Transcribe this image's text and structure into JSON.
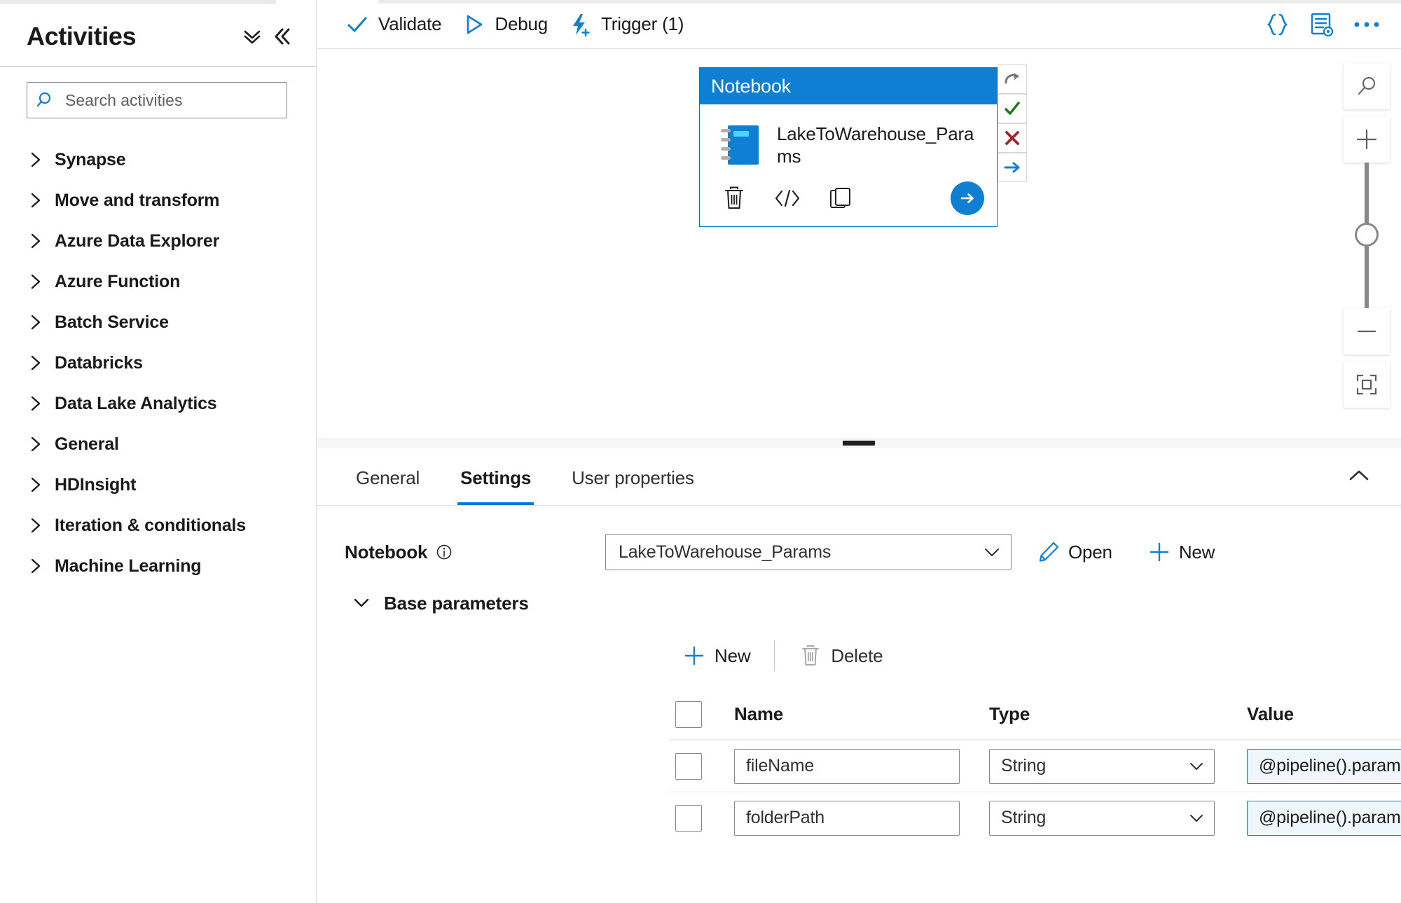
{
  "sidebar": {
    "title": "Activities",
    "collapse_all_icon": "double-chevron-down-icon",
    "collapse_panel_icon": "double-chevron-left-icon",
    "search": {
      "placeholder": "Search activities",
      "value": "",
      "icon": "search-icon"
    },
    "categories": [
      {
        "label": "Synapse",
        "expanded": false
      },
      {
        "label": "Move and transform",
        "expanded": false
      },
      {
        "label": "Azure Data Explorer",
        "expanded": false
      },
      {
        "label": "Azure Function",
        "expanded": false
      },
      {
        "label": "Batch Service",
        "expanded": false
      },
      {
        "label": "Databricks",
        "expanded": false
      },
      {
        "label": "Data Lake Analytics",
        "expanded": false
      },
      {
        "label": "General",
        "expanded": false
      },
      {
        "label": "HDInsight",
        "expanded": false
      },
      {
        "label": "Iteration & conditionals",
        "expanded": false
      },
      {
        "label": "Machine Learning",
        "expanded": false
      }
    ]
  },
  "commandbar": {
    "validate_label": "Validate",
    "validate_icon": "checkmark-icon",
    "debug_label": "Debug",
    "debug_icon": "play-triangle-icon",
    "trigger_label": "Trigger (1)",
    "trigger_icon": "lightning-bolt-plus-icon",
    "code_icon": "curly-braces-icon",
    "properties_icon": "document-gear-icon",
    "more_icon": "ellipsis-icon"
  },
  "canvas": {
    "node": {
      "type_label": "Notebook",
      "activity_name": "LakeToWarehouse_Params",
      "activity_icon": "notebook-icon",
      "actions": [
        {
          "name": "delete",
          "icon": "trash-icon"
        },
        {
          "name": "code",
          "icon": "code-brackets-icon"
        },
        {
          "name": "clone",
          "icon": "copy-icon"
        },
        {
          "name": "run",
          "icon": "arrow-right-circle-icon"
        }
      ],
      "handles": [
        {
          "name": "on-skip",
          "icon": "curved-arrow-icon",
          "color": "#797775"
        },
        {
          "name": "on-success",
          "icon": "checkmark-icon",
          "color": "#107c10"
        },
        {
          "name": "on-failure",
          "icon": "x-icon",
          "color": "#a4262c"
        },
        {
          "name": "on-completion",
          "icon": "arrow-right-icon",
          "color": "#0f7fd4"
        }
      ]
    },
    "zoom_controls": [
      {
        "name": "zoom-search",
        "icon": "magnifier-icon"
      },
      {
        "name": "zoom-in",
        "icon": "plus-icon"
      },
      {
        "name": "zoom-slider",
        "icon": "slider-thumb"
      },
      {
        "name": "zoom-out",
        "icon": "minus-icon"
      },
      {
        "name": "zoom-to-fit",
        "icon": "fit-to-screen-icon"
      }
    ],
    "splitter_icon": "drag-handle-icon"
  },
  "properties": {
    "tabs": [
      {
        "label": "General",
        "active": false
      },
      {
        "label": "Settings",
        "active": true
      },
      {
        "label": "User properties",
        "active": false
      }
    ],
    "collapse_icon": "chevron-up-icon",
    "notebook_field": {
      "label": "Notebook",
      "info_icon": "info-icon",
      "selected_value": "LakeToWarehouse_Params",
      "chevron_icon": "chevron-down-icon",
      "open_label": "Open",
      "open_icon": "pencil-icon",
      "new_label": "New",
      "new_icon": "plus-icon"
    },
    "base_parameters": {
      "section_label": "Base parameters",
      "section_chevron_icon": "chevron-down-icon",
      "new_label": "New",
      "new_icon": "plus-icon",
      "delete_label": "Delete",
      "delete_icon": "trash-icon",
      "columns": [
        "Name",
        "Type",
        "Value"
      ],
      "rows": [
        {
          "checked": false,
          "name": "fileName",
          "type": "String",
          "value": "@pipeline().parameters.fileName"
        },
        {
          "checked": false,
          "name": "folderPath",
          "type": "String",
          "value": "@pipeline().parameters.folderPath"
        }
      ]
    }
  },
  "colors": {
    "accent": "#0078d4",
    "node_header": "#0f7fd4",
    "success": "#107c10",
    "failure": "#a4262c",
    "dynamic_bg": "#eff6fc"
  }
}
